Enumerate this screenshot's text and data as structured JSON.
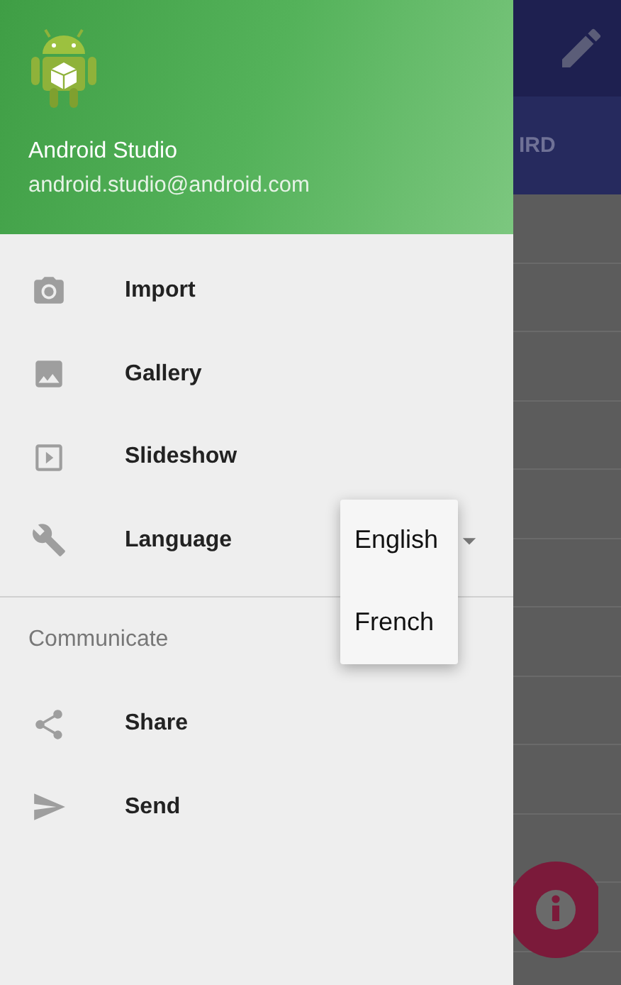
{
  "header": {
    "name": "Android Studio",
    "email": "android.studio@android.com"
  },
  "menu": [
    {
      "label": "Import",
      "kind": "action"
    },
    {
      "label": "Gallery",
      "kind": "action"
    },
    {
      "label": "Slideshow",
      "kind": "action"
    },
    {
      "label": "Language",
      "kind": "spinner"
    }
  ],
  "section": {
    "title": "Communicate",
    "items": [
      {
        "label": "Share"
      },
      {
        "label": "Send"
      }
    ]
  },
  "language_dropdown": {
    "options": [
      {
        "label": "English"
      },
      {
        "label": "French"
      }
    ]
  },
  "background": {
    "tab_label": "IRD"
  }
}
